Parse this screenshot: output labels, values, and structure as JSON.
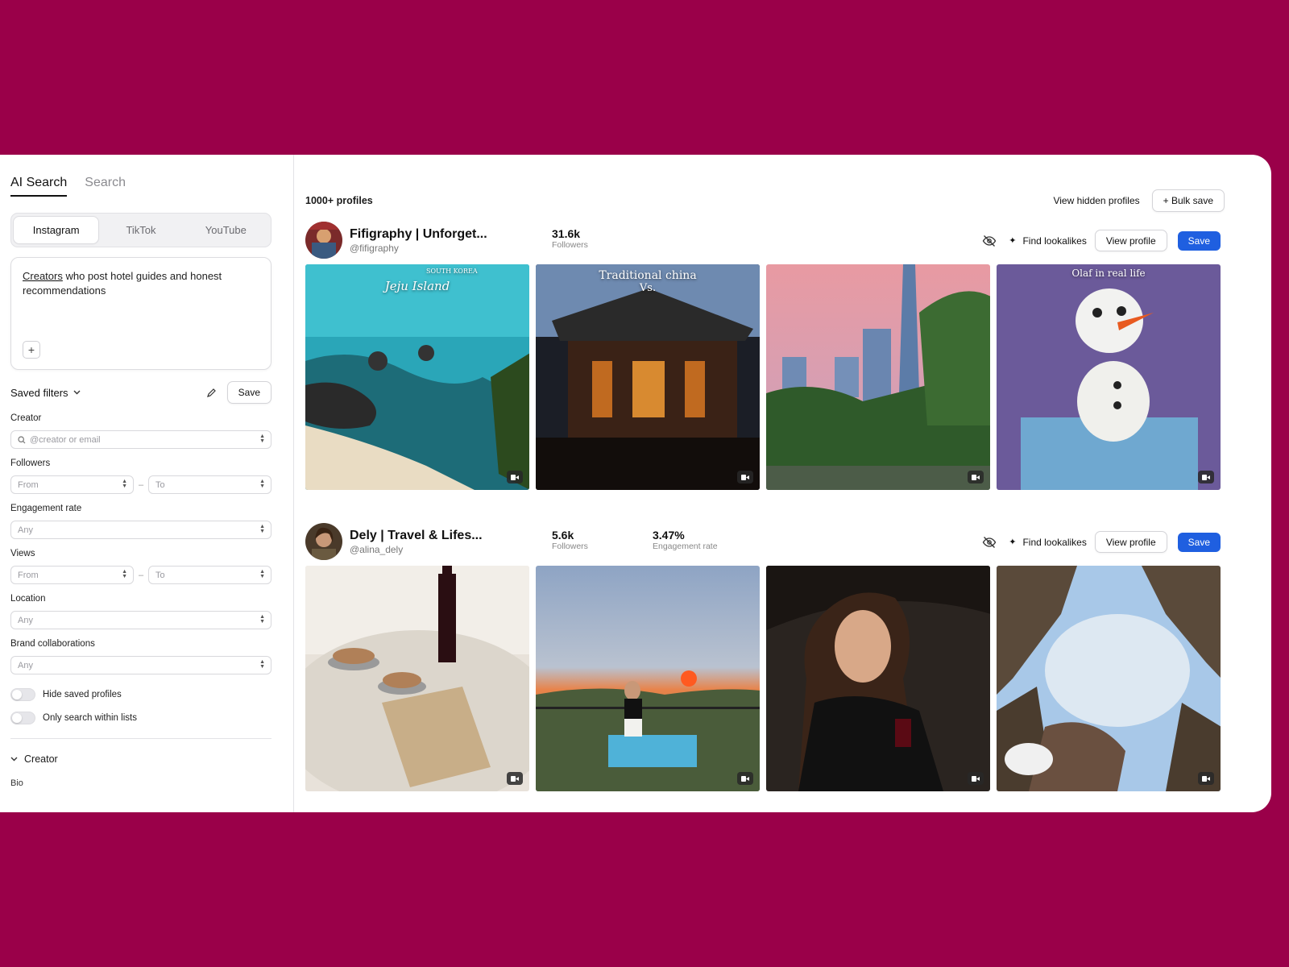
{
  "sidebar": {
    "tabs": [
      {
        "label": "AI Search"
      },
      {
        "label": "Search"
      }
    ],
    "platforms": [
      {
        "label": "Instagram"
      },
      {
        "label": "TikTok"
      },
      {
        "label": "YouTube"
      }
    ],
    "prompt": {
      "highlight": "Creators",
      "rest": " who post hotel guides and honest recommendations"
    },
    "saved_filters_label": "Saved filters",
    "save_label": "Save",
    "creator_label": "Creator",
    "creator_placeholder": "@creator or email",
    "followers_label": "Followers",
    "from_placeholder": "From",
    "to_placeholder": "To",
    "engagement_label": "Engagement rate",
    "any_placeholder": "Any",
    "views_label": "Views",
    "location_label": "Location",
    "brand_label": "Brand collaborations",
    "hide_saved_label": "Hide saved profiles",
    "only_lists_label": "Only search within lists",
    "creator_section_label": "Creator",
    "bio_label": "Bio"
  },
  "main": {
    "count": "1000+ profiles",
    "view_hidden": "View hidden profiles",
    "bulk_save": "+ Bulk save",
    "find_lookalikes": "Find lookalikes",
    "view_profile": "View profile",
    "save": "Save",
    "profiles": [
      {
        "name": "Fifigraphy | Unforget...",
        "handle": "@fifigraphy",
        "followers": "31.6k",
        "followers_label": "Followers",
        "captions": [
          "Jeju Island",
          "SOUTH KOREA",
          "Traditional china",
          "Vs.",
          "",
          "Olaf in real life"
        ]
      },
      {
        "name": "Dely | Travel & Lifes...",
        "handle": "@alina_dely",
        "followers": "5.6k",
        "followers_label": "Followers",
        "engagement": "3.47%",
        "engagement_label": "Engagement rate"
      }
    ]
  },
  "colors": {
    "background": "#9a0049",
    "primary": "#1f5fe0"
  }
}
